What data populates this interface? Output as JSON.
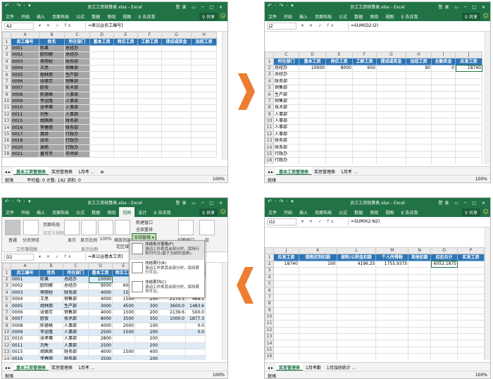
{
  "w1": {
    "title": "员工工资核算表.xlsx - Excel",
    "quick": "↶ · ↷ · ▾",
    "login": "登录",
    "menu": [
      "文件",
      "开始",
      "插入",
      "页面布局",
      "公式",
      "数据",
      "审阅",
      "视图"
    ],
    "tell": "♀ 告诉我",
    "share": "♀ 共享",
    "namebox": "A2",
    "formula": "=表1[@员工编号]",
    "cols": [
      "",
      "A",
      "B",
      "C",
      "D",
      "E",
      "F",
      "G",
      "H"
    ],
    "headers": [
      "员工编号",
      "姓名",
      "所在部门",
      "基本工资",
      "岗位工资",
      "工龄工资",
      "提成或奖金",
      "加班工资"
    ],
    "rows": [
      [
        "2",
        "0001",
        "陈果",
        "总经办"
      ],
      [
        "3",
        "0002",
        "欧阳娜",
        "总经办"
      ],
      [
        "4",
        "0003",
        "蒋丽程",
        "财务部"
      ],
      [
        "5",
        "0004",
        "王思",
        "销售部"
      ],
      [
        "6",
        "0005",
        "胡林丽",
        "生产部"
      ],
      [
        "7",
        "0006",
        "张德芳",
        "销售部"
      ],
      [
        "8",
        "0007",
        "欧俊",
        "技术部"
      ],
      [
        "9",
        "0008",
        "陈德格",
        "人事部"
      ],
      [
        "10",
        "0009",
        "李运隆",
        "人事部"
      ],
      [
        "11",
        "0010",
        "张孝骞",
        "人事部"
      ],
      [
        "12",
        "0011",
        "刘秀",
        "人事部"
      ],
      [
        "13",
        "0015",
        "胡茜茜",
        "财务部"
      ],
      [
        "14",
        "0016",
        "李春丽",
        "财务部"
      ],
      [
        "15",
        "0017",
        "袁娇",
        "行政办"
      ],
      [
        "16",
        "0018",
        "张伟",
        "行政办"
      ],
      [
        "17",
        "0020",
        "谢艳",
        "行政办"
      ],
      [
        "18",
        "0021",
        "童可可",
        "市场部"
      ]
    ],
    "sheets": [
      "基本工资管理表",
      "奖惩管理表",
      "1月考 ...",
      "⊕"
    ],
    "status": "就绪",
    "status_mid": "平均值: 0   计数: 192   求和: 0",
    "zoom": "100%"
  },
  "w2": {
    "title": "员工工资核算表.xlsx - Excel",
    "login": "登录",
    "menu": [
      "文件",
      "开始",
      "插入",
      "页面布局",
      "公式",
      "数据",
      "审阅",
      "视图"
    ],
    "tell": "♀ 告诉我",
    "share": "♀ 共享",
    "namebox": "J2",
    "formula": "=SUM(D2:I2)",
    "cols": [
      "",
      "C",
      "D",
      "E",
      "F",
      "G",
      "H",
      "I",
      "J"
    ],
    "headers": [
      "所在部门",
      "基本工资",
      "岗位工资",
      "工龄工资",
      "提成或奖金",
      "加班工资",
      "全勤奖金",
      "应发工资"
    ],
    "row2": [
      "总经办",
      "10000",
      "8000",
      "650",
      "",
      "90",
      "0",
      "18740"
    ],
    "depts": [
      "总经办",
      "财务部",
      "销售部",
      "生产部",
      "销售部",
      "技术部",
      "人事部",
      "人事部",
      "人事部",
      "人事部",
      "财务部",
      "财务部",
      "行政办",
      "行政办"
    ],
    "sheets": [
      "基本工资管理表",
      "奖惩管理表",
      "1月考 ..."
    ],
    "status": "就绪",
    "zoom": "100%"
  },
  "w3": {
    "title": "员工工资核算表.xlsx - Excel",
    "login": "登录",
    "menu": [
      "文件",
      "开始",
      "插入",
      "页面布局",
      "公式",
      "数据",
      "审阅",
      "视图",
      "设计"
    ],
    "tell": "♀ 告诉我",
    "share": "♀ 共享",
    "ribbon": {
      "normal": "普通",
      "page_break": "分页预览",
      "page_layout": "页面布局",
      "custom_view": "自定义视图",
      "group_views": "工作簿视图",
      "show": "显示",
      "zoom": "显示比例",
      "zoom100": "100%",
      "zoom_sel": "缩放到选定区域",
      "group_zoom": "显示比例",
      "new_window": "新建窗口",
      "arrange_all": "全部重排",
      "freeze": "冻结窗格 ▾",
      "switch": "切换窗口",
      "macro": "宏"
    },
    "menu_items": [
      {
        "title": "冻结拆分窗格(F)",
        "desc": "滚动工作表其余部分时，保持行和列可见(基于当前的选择)。"
      },
      {
        "title": "冻结首行(R)",
        "desc": "滚动工作表其余部分时，保持首行可见。"
      },
      {
        "title": "冻结首列(C)",
        "desc": "滚动工作表其余部分时，保持首列可见。"
      }
    ],
    "namebox": "D2",
    "formula": "=表1[@基本工资]",
    "cols": [
      "",
      "A",
      "B",
      "C",
      "D",
      "E",
      "F",
      "G",
      "H"
    ],
    "headers": [
      "员工编号",
      "姓名",
      "所在部门",
      "基本工资",
      "岗位工资",
      "工龄工资",
      "提成或奖金",
      "全勤奖"
    ],
    "rows": [
      [
        "2",
        "0001",
        "陈果",
        "总经办",
        "10000",
        "",
        "",
        "",
        ""
      ],
      [
        "3",
        "0002",
        "欧阳娜",
        "总经办",
        "9000",
        "6000",
        "350",
        "",
        "0.0"
      ],
      [
        "4",
        "0003",
        "蒋丽程",
        "财务部",
        "4000",
        "1500",
        "250",
        "",
        "0.0"
      ],
      [
        "5",
        "0004",
        "王思",
        "销售部",
        "4000",
        "1500",
        "250",
        "2170.3",
        "469.1"
      ],
      [
        "6",
        "0005",
        "胡林丽",
        "生产部",
        "3000",
        "4500",
        "300",
        "3600.0",
        "1483.6"
      ],
      [
        "7",
        "0006",
        "张德芳",
        "销售部",
        "4000",
        "1500",
        "200",
        "2139.6",
        "500.0"
      ],
      [
        "8",
        "0007",
        "欧俊",
        "技术部",
        "8000",
        "3500",
        "350",
        "1000.0",
        "1877.3"
      ],
      [
        "9",
        "0008",
        "陈德格",
        "人事部",
        "4000",
        "2000",
        "100",
        "",
        "0.0"
      ],
      [
        "10",
        "0009",
        "李运隆",
        "人事部",
        "2500",
        "1500",
        "200",
        "",
        "0.0"
      ],
      [
        "11",
        "0010",
        "张孝骞",
        "人事部",
        "2800",
        "",
        "200",
        "",
        ""
      ],
      [
        "12",
        "0011",
        "刘秀",
        "人事部",
        "2500",
        "",
        "200",
        "",
        ""
      ],
      [
        "13",
        "0015",
        "胡茜茜",
        "财务部",
        "4000",
        "1500",
        "400",
        "",
        ""
      ],
      [
        "14",
        "0016",
        "李春丽",
        "财务部",
        "3500",
        "",
        "200",
        "",
        ""
      ]
    ],
    "sheets": [
      "基本工资管理表",
      "奖惩管理表",
      "1月考 ..."
    ],
    "status": "就绪",
    "zoom": "100%"
  },
  "w4": {
    "title": "员工工资核算表.xlsx - Excel",
    "login": "登录",
    "menu": [
      "文件",
      "开始",
      "插入",
      "页面布局",
      "公式",
      "数据",
      "审阅",
      "视图"
    ],
    "tell": "♀ 告诉我",
    "share": "♀ 共享",
    "namebox": "O2",
    "formula": "=SUM(K2:N2)",
    "cols": [
      "",
      "J",
      "K",
      "L",
      "M",
      "N",
      "O",
      "P"
    ],
    "headers": [
      "应发工资",
      "请假迟到扣款",
      "保险/公积金扣款",
      "个人所得税",
      "其他扣款",
      "应扣合计",
      "实发工资"
    ],
    "row2": [
      "18740",
      "100",
      "4196.25",
      "1755.9375",
      "",
      "6052.1875",
      ""
    ],
    "sheets": [
      "奖惩管理表",
      "1月考勤",
      "1月加班统计 ..."
    ],
    "status": "就绪",
    "zoom": "100%"
  },
  "arrow_color": "#ed7d31"
}
